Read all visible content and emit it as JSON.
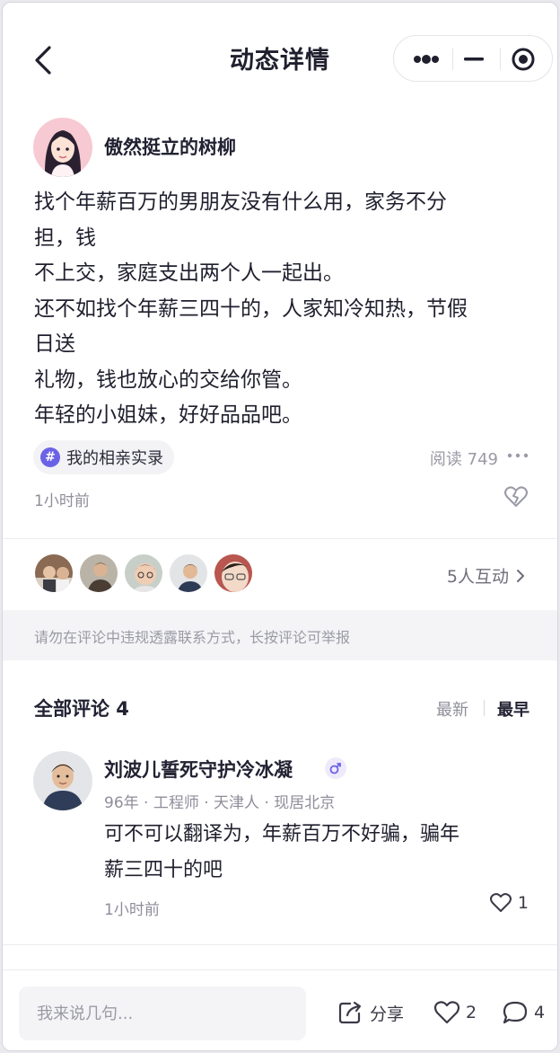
{
  "header": {
    "title": "动态详情"
  },
  "post": {
    "author_name": "傲然挺立的树柳",
    "lines": [
      "找个年薪百万的男朋友没有什么用，家务不分",
      "担，钱",
      "不上交，家庭支出两个人一起出。",
      "还不如找个年薪三四十的，人家知冷知热，节假",
      "日送",
      "礼物，钱也放心的交给你管。",
      "年轻的小姐妹，好好品品吧。"
    ],
    "topic": "我的相亲实录",
    "read_count": "阅读 749",
    "time": "1小时前"
  },
  "interactions": {
    "count_label": "5人互动"
  },
  "notice": "请勿在评论中违规透露联系方式，长按评论可举报",
  "comments": {
    "title": "全部评论 4",
    "sort_newest": "最新",
    "sort_earliest": "最早",
    "items": [
      {
        "name": "刘波儿誓死守护冷冰凝",
        "meta": "96年 · 工程师 · 天津人 · 现居北京",
        "text_lines": [
          "可不可以翻译为，年薪百万不好骗，骗年",
          "薪三四十的吧"
        ],
        "time": "1小时前",
        "likes": "1"
      }
    ]
  },
  "footer": {
    "input_placeholder": "我来说几句...",
    "share_label": "分享",
    "like_count": "2",
    "comment_count": "4"
  },
  "colors": {
    "accent": "#6b63e6",
    "text": "#1f1f2e",
    "muted": "#8e8e9a"
  }
}
